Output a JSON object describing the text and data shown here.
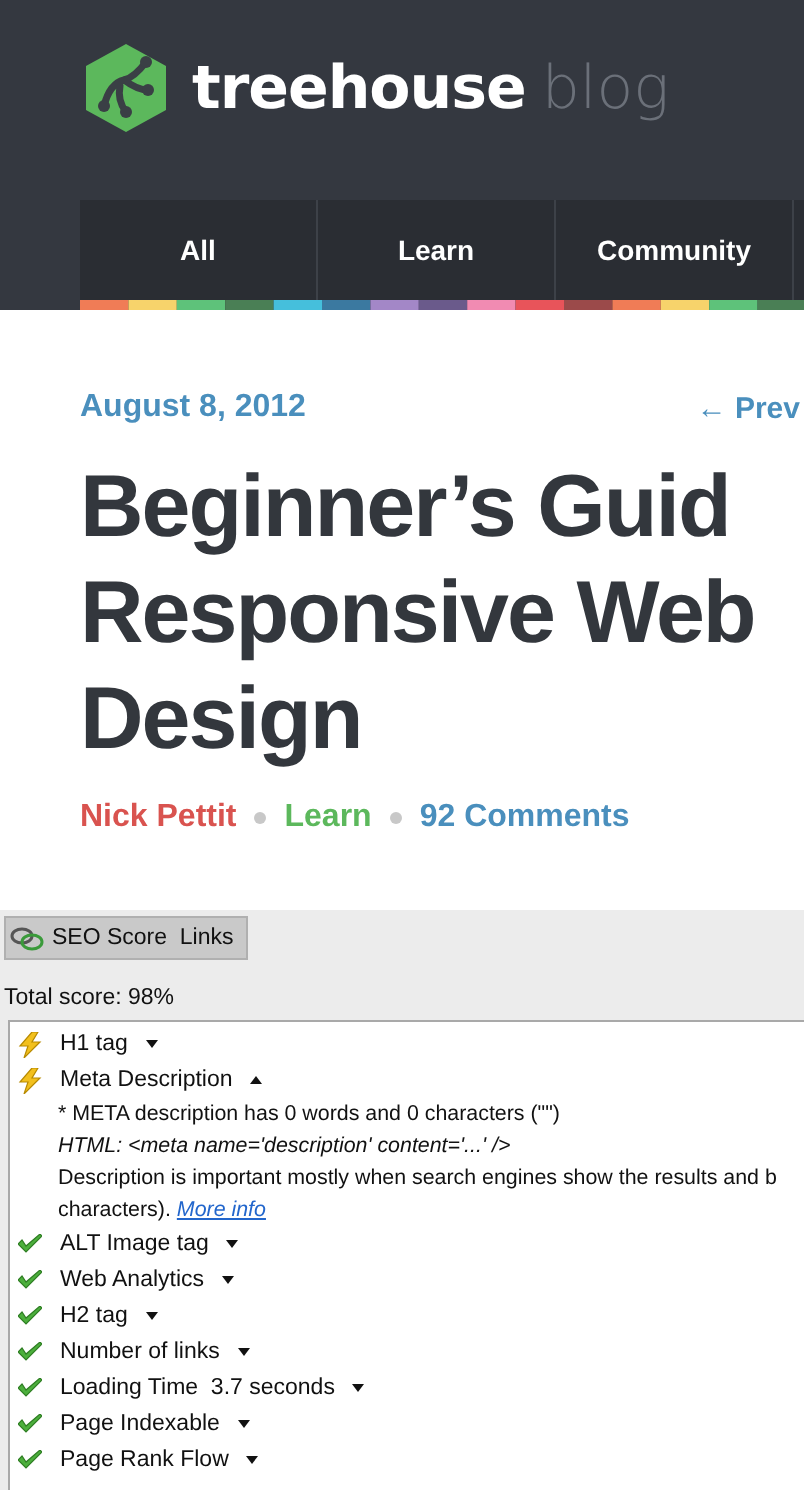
{
  "header": {
    "logo_word": "treehouse",
    "logo_suffix": "blog",
    "nav": [
      {
        "label": "All"
      },
      {
        "label": "Learn"
      },
      {
        "label": "Community"
      }
    ]
  },
  "article": {
    "date": "August 8, 2012",
    "prev_link": "← Prev",
    "title_lines": [
      "Beginner’s Guid",
      "Responsive Web",
      "Design"
    ],
    "author": "Nick Pettit",
    "category": "Learn",
    "comments": "92 Comments"
  },
  "seo_panel": {
    "tab_label": "SEO Score  Links",
    "total": "Total score: 98%",
    "items": [
      {
        "kind": "warning",
        "label": "H1 tag",
        "expanded": false
      },
      {
        "kind": "warning",
        "label": "Meta Description",
        "expanded": true,
        "details": {
          "note": "* META description has 0 words and 0 characters (\"\")",
          "html": "HTML: <meta name='description' content='...' />",
          "text": "Description is important mostly when search engines show the results and b",
          "text_end": "characters).",
          "link": "More info"
        }
      },
      {
        "kind": "ok",
        "label": "ALT Image tag",
        "expanded": false
      },
      {
        "kind": "ok",
        "label": "Web Analytics",
        "expanded": false
      },
      {
        "kind": "ok",
        "label": "H2 tag",
        "expanded": false
      },
      {
        "kind": "ok",
        "label": "Number of links",
        "expanded": false
      },
      {
        "kind": "ok",
        "label": "Loading Time",
        "value": "3.7 seconds",
        "expanded": false
      },
      {
        "kind": "ok",
        "label": "Page Indexable",
        "expanded": false
      },
      {
        "kind": "ok",
        "label": "Page Rank Flow",
        "expanded": false
      }
    ]
  }
}
